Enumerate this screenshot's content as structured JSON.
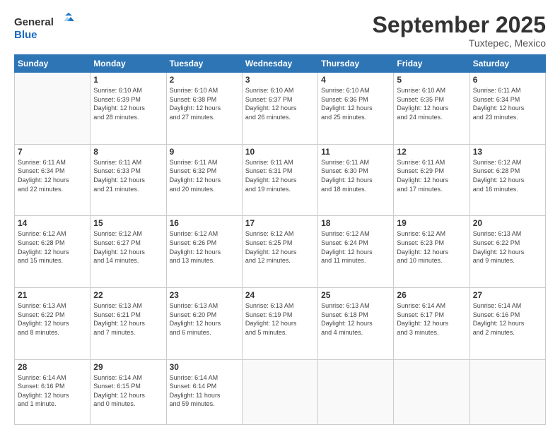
{
  "header": {
    "logo_line1": "General",
    "logo_line2": "Blue",
    "month": "September 2025",
    "location": "Tuxtepec, Mexico"
  },
  "days_of_week": [
    "Sunday",
    "Monday",
    "Tuesday",
    "Wednesday",
    "Thursday",
    "Friday",
    "Saturday"
  ],
  "weeks": [
    [
      {
        "day": "",
        "info": ""
      },
      {
        "day": "1",
        "info": "Sunrise: 6:10 AM\nSunset: 6:39 PM\nDaylight: 12 hours\nand 28 minutes."
      },
      {
        "day": "2",
        "info": "Sunrise: 6:10 AM\nSunset: 6:38 PM\nDaylight: 12 hours\nand 27 minutes."
      },
      {
        "day": "3",
        "info": "Sunrise: 6:10 AM\nSunset: 6:37 PM\nDaylight: 12 hours\nand 26 minutes."
      },
      {
        "day": "4",
        "info": "Sunrise: 6:10 AM\nSunset: 6:36 PM\nDaylight: 12 hours\nand 25 minutes."
      },
      {
        "day": "5",
        "info": "Sunrise: 6:10 AM\nSunset: 6:35 PM\nDaylight: 12 hours\nand 24 minutes."
      },
      {
        "day": "6",
        "info": "Sunrise: 6:11 AM\nSunset: 6:34 PM\nDaylight: 12 hours\nand 23 minutes."
      }
    ],
    [
      {
        "day": "7",
        "info": "Sunrise: 6:11 AM\nSunset: 6:34 PM\nDaylight: 12 hours\nand 22 minutes."
      },
      {
        "day": "8",
        "info": "Sunrise: 6:11 AM\nSunset: 6:33 PM\nDaylight: 12 hours\nand 21 minutes."
      },
      {
        "day": "9",
        "info": "Sunrise: 6:11 AM\nSunset: 6:32 PM\nDaylight: 12 hours\nand 20 minutes."
      },
      {
        "day": "10",
        "info": "Sunrise: 6:11 AM\nSunset: 6:31 PM\nDaylight: 12 hours\nand 19 minutes."
      },
      {
        "day": "11",
        "info": "Sunrise: 6:11 AM\nSunset: 6:30 PM\nDaylight: 12 hours\nand 18 minutes."
      },
      {
        "day": "12",
        "info": "Sunrise: 6:11 AM\nSunset: 6:29 PM\nDaylight: 12 hours\nand 17 minutes."
      },
      {
        "day": "13",
        "info": "Sunrise: 6:12 AM\nSunset: 6:28 PM\nDaylight: 12 hours\nand 16 minutes."
      }
    ],
    [
      {
        "day": "14",
        "info": "Sunrise: 6:12 AM\nSunset: 6:28 PM\nDaylight: 12 hours\nand 15 minutes."
      },
      {
        "day": "15",
        "info": "Sunrise: 6:12 AM\nSunset: 6:27 PM\nDaylight: 12 hours\nand 14 minutes."
      },
      {
        "day": "16",
        "info": "Sunrise: 6:12 AM\nSunset: 6:26 PM\nDaylight: 12 hours\nand 13 minutes."
      },
      {
        "day": "17",
        "info": "Sunrise: 6:12 AM\nSunset: 6:25 PM\nDaylight: 12 hours\nand 12 minutes."
      },
      {
        "day": "18",
        "info": "Sunrise: 6:12 AM\nSunset: 6:24 PM\nDaylight: 12 hours\nand 11 minutes."
      },
      {
        "day": "19",
        "info": "Sunrise: 6:12 AM\nSunset: 6:23 PM\nDaylight: 12 hours\nand 10 minutes."
      },
      {
        "day": "20",
        "info": "Sunrise: 6:13 AM\nSunset: 6:22 PM\nDaylight: 12 hours\nand 9 minutes."
      }
    ],
    [
      {
        "day": "21",
        "info": "Sunrise: 6:13 AM\nSunset: 6:22 PM\nDaylight: 12 hours\nand 8 minutes."
      },
      {
        "day": "22",
        "info": "Sunrise: 6:13 AM\nSunset: 6:21 PM\nDaylight: 12 hours\nand 7 minutes."
      },
      {
        "day": "23",
        "info": "Sunrise: 6:13 AM\nSunset: 6:20 PM\nDaylight: 12 hours\nand 6 minutes."
      },
      {
        "day": "24",
        "info": "Sunrise: 6:13 AM\nSunset: 6:19 PM\nDaylight: 12 hours\nand 5 minutes."
      },
      {
        "day": "25",
        "info": "Sunrise: 6:13 AM\nSunset: 6:18 PM\nDaylight: 12 hours\nand 4 minutes."
      },
      {
        "day": "26",
        "info": "Sunrise: 6:14 AM\nSunset: 6:17 PM\nDaylight: 12 hours\nand 3 minutes."
      },
      {
        "day": "27",
        "info": "Sunrise: 6:14 AM\nSunset: 6:16 PM\nDaylight: 12 hours\nand 2 minutes."
      }
    ],
    [
      {
        "day": "28",
        "info": "Sunrise: 6:14 AM\nSunset: 6:16 PM\nDaylight: 12 hours\nand 1 minute."
      },
      {
        "day": "29",
        "info": "Sunrise: 6:14 AM\nSunset: 6:15 PM\nDaylight: 12 hours\nand 0 minutes."
      },
      {
        "day": "30",
        "info": "Sunrise: 6:14 AM\nSunset: 6:14 PM\nDaylight: 11 hours\nand 59 minutes."
      },
      {
        "day": "",
        "info": ""
      },
      {
        "day": "",
        "info": ""
      },
      {
        "day": "",
        "info": ""
      },
      {
        "day": "",
        "info": ""
      }
    ]
  ]
}
